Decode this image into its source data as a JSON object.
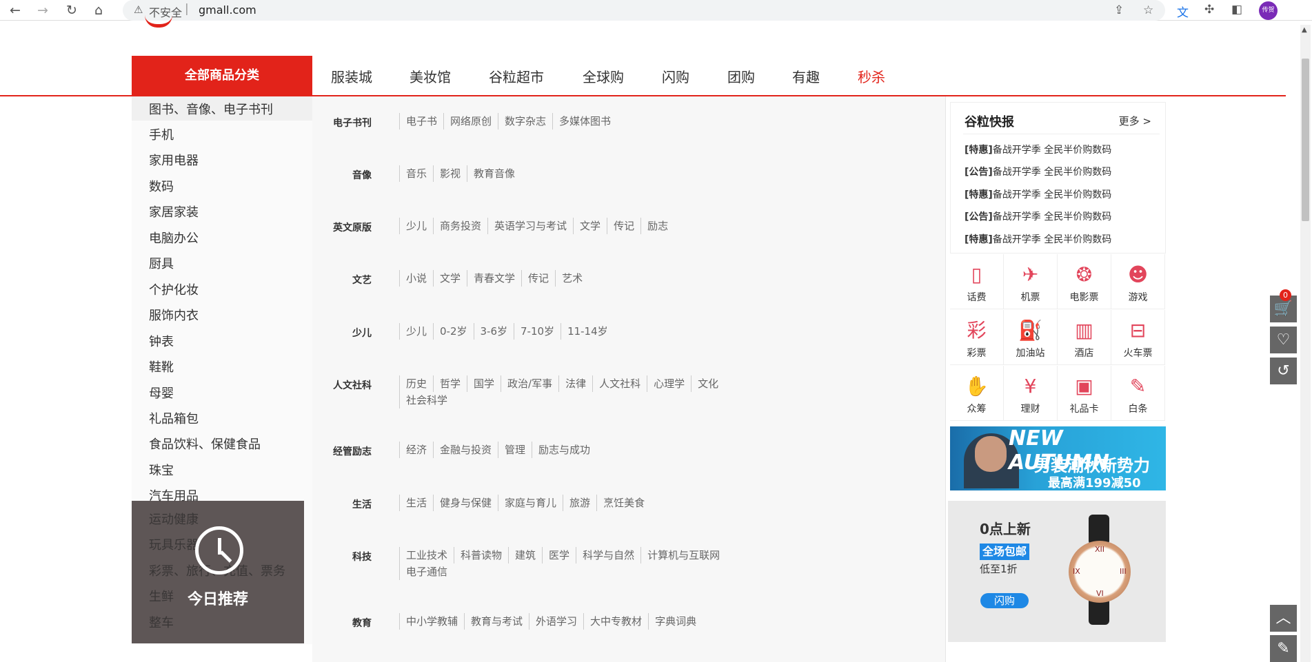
{
  "browser": {
    "insecure_label": "不安全",
    "url": "gmall.com",
    "profile_label": "传贺"
  },
  "nav": {
    "all_categories": "全部商品分类",
    "items": [
      "服装城",
      "美妆馆",
      "谷粒超市",
      "全球购",
      "闪购",
      "团购",
      "有趣",
      "秒杀"
    ]
  },
  "categories": [
    "图书、音像、电子书刊",
    "手机",
    "家用电器",
    "数码",
    "家居家装",
    "电脑办公",
    "厨具",
    "个护化妆",
    "服饰内衣",
    "钟表",
    "鞋靴",
    "母婴",
    "礼品箱包",
    "食品饮料、保健食品",
    "珠宝",
    "汽车用品",
    "运动健康",
    "玩具乐器",
    "彩票、旅行、充值、票务",
    "生鲜",
    "整车"
  ],
  "today": {
    "label": "今日推荐"
  },
  "subcategories": [
    {
      "title": "电子书刊",
      "links": [
        "电子书",
        "网络原创",
        "数字杂志",
        "多媒体图书"
      ]
    },
    {
      "title": "音像",
      "links": [
        "音乐",
        "影视",
        "教育音像"
      ]
    },
    {
      "title": "英文原版",
      "links": [
        "少儿",
        "商务投资",
        "英语学习与考试",
        "文学",
        "传记",
        "励志"
      ]
    },
    {
      "title": "文艺",
      "links": [
        "小说",
        "文学",
        "青春文学",
        "传记",
        "艺术"
      ]
    },
    {
      "title": "少儿",
      "links": [
        "少儿",
        "0-2岁",
        "3-6岁",
        "7-10岁",
        "11-14岁"
      ]
    },
    {
      "title": "人文社科",
      "links": [
        "历史",
        "哲学",
        "国学",
        "政治/军事",
        "法律",
        "人文社科",
        "心理学",
        "文化",
        "社会科学"
      ]
    },
    {
      "title": "经管励志",
      "links": [
        "经济",
        "金融与投资",
        "管理",
        "励志与成功"
      ]
    },
    {
      "title": "生活",
      "links": [
        "生活",
        "健身与保健",
        "家庭与育儿",
        "旅游",
        "烹饪美食"
      ]
    },
    {
      "title": "科技",
      "links": [
        "工业技术",
        "科普读物",
        "建筑",
        "医学",
        "科学与自然",
        "计算机与互联网",
        "电子通信"
      ]
    },
    {
      "title": "教育",
      "links": [
        "中小学教辅",
        "教育与考试",
        "外语学习",
        "大中专教材",
        "字典词典"
      ]
    }
  ],
  "news": {
    "title": "谷粒快报",
    "more": "更多 >",
    "items": [
      {
        "tag": "[特惠]",
        "text": "备战开学季 全民半价购数码"
      },
      {
        "tag": "[公告]",
        "text": "备战开学季 全民半价购数码"
      },
      {
        "tag": "[特惠]",
        "text": "备战开学季 全民半价购数码"
      },
      {
        "tag": "[公告]",
        "text": "备战开学季 全民半价购数码"
      },
      {
        "tag": "[特惠]",
        "text": "备战开学季 全民半价购数码"
      }
    ]
  },
  "services": [
    {
      "label": "话费",
      "icon": "phone-icon",
      "glyph": "▯"
    },
    {
      "label": "机票",
      "icon": "plane-icon",
      "glyph": "✈"
    },
    {
      "label": "电影票",
      "icon": "film-icon",
      "glyph": "❂"
    },
    {
      "label": "游戏",
      "icon": "game-icon",
      "glyph": "☻"
    },
    {
      "label": "彩票",
      "icon": "lottery-icon",
      "glyph": "彩"
    },
    {
      "label": "加油站",
      "icon": "gas-station-icon",
      "glyph": "⛽"
    },
    {
      "label": "酒店",
      "icon": "hotel-icon",
      "glyph": "▥"
    },
    {
      "label": "火车票",
      "icon": "train-icon",
      "glyph": "⊟"
    },
    {
      "label": "众筹",
      "icon": "crowdfunding-icon",
      "glyph": "✋"
    },
    {
      "label": "理财",
      "icon": "finance-icon",
      "glyph": "¥"
    },
    {
      "label": "礼品卡",
      "icon": "gift-card-icon",
      "glyph": "▣"
    },
    {
      "label": "白条",
      "icon": "credit-icon",
      "glyph": "✎"
    }
  ],
  "banner": {
    "headline": "NEW AUTUMN",
    "sub1": "男装潮秋新势力",
    "sub2": "最高满199减50"
  },
  "flash": {
    "title": "0点上新",
    "badge": "全场包邮",
    "sub": "低至1折",
    "button": "闪购"
  },
  "toolbar": {
    "cart_count": "0"
  },
  "colors": {
    "brand_red": "#e2231a",
    "accent_blue": "#1e88e5"
  }
}
